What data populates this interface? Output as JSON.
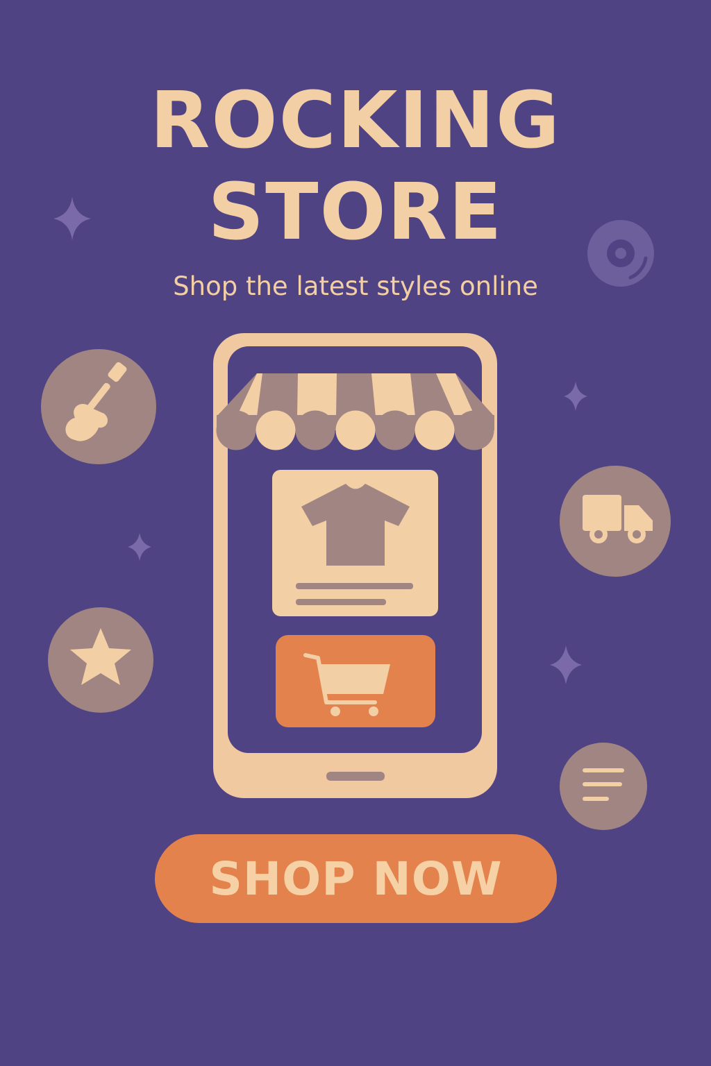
{
  "header": {
    "title_line1": "ROCKING",
    "title_line2": "STORE",
    "subtitle": "Shop the latest styles online"
  },
  "cta": {
    "label": "SHOP NOW"
  },
  "icons": {
    "left": [
      "guitar-icon",
      "star-icon"
    ],
    "right": [
      "vinyl-record-icon",
      "delivery-truck-icon",
      "menu-lines-icon"
    ],
    "phone": [
      "store-awning",
      "tshirt-icon",
      "shopping-cart-icon"
    ]
  },
  "colors": {
    "background": "#504383",
    "cream": "#f3cfa6",
    "mauve": "#a18582",
    "accent_orange": "#e3824d",
    "sparkle": "#7b6aa9"
  }
}
